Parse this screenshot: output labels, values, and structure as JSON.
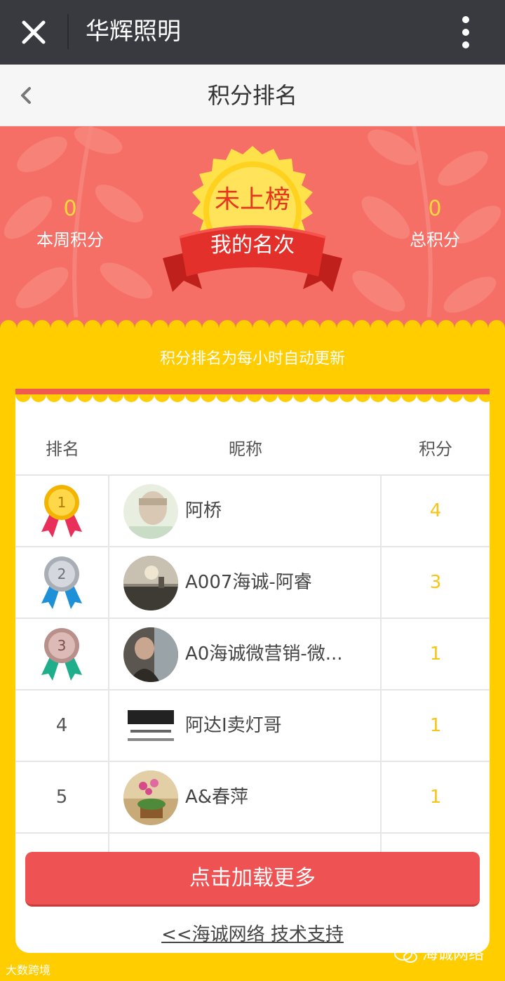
{
  "titlebar": {
    "title": "华辉照明",
    "close_icon": "close-icon",
    "more_icon": "more-vertical-icon"
  },
  "nav": {
    "title": "积分排名",
    "back_icon": "chevron-left-icon"
  },
  "hero": {
    "week_points_value": "0",
    "week_points_label": "本周积分",
    "total_points_value": "0",
    "total_points_label": "总积分",
    "my_rank_value": "未上榜",
    "my_rank_label": "我的名次"
  },
  "notice": "积分排名为每小时自动更新",
  "table": {
    "headers": {
      "rank": "排名",
      "nickname": "昵称",
      "points": "积分"
    },
    "rows": [
      {
        "rank": "1",
        "medal": "gold",
        "nickname": "阿桥",
        "points": "4"
      },
      {
        "rank": "2",
        "medal": "silver",
        "nickname": "A007海诚-阿睿",
        "points": "3"
      },
      {
        "rank": "3",
        "medal": "bronze",
        "nickname": "A0海诚微营销-微...",
        "points": "1"
      },
      {
        "rank": "4",
        "medal": "",
        "nickname": "阿达I卖灯哥",
        "points": "1"
      },
      {
        "rank": "5",
        "medal": "",
        "nickname": "A&春萍",
        "points": "1"
      }
    ]
  },
  "load_more": "点击加载更多",
  "support": "<<海诚网络 技术支持",
  "watermark_left": "大数跨境",
  "watermark_right": "海诚网络",
  "colors": {
    "titlebar": "#393a3f",
    "hero": "#f56f66",
    "page": "#ffcd00",
    "accent_red": "#ef5252",
    "score_yellow": "#f5c518"
  }
}
